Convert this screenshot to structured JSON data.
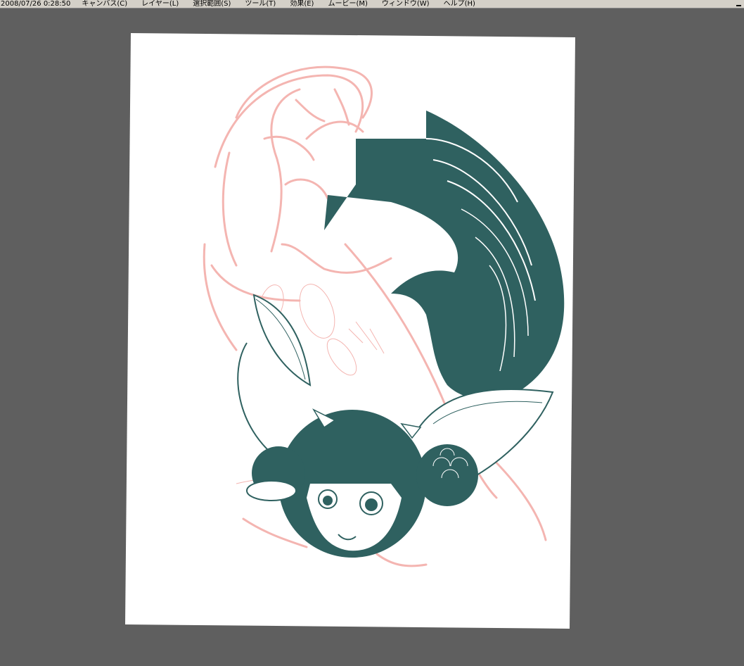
{
  "menubar": {
    "timestamp": "2008/07/26 0:28:50",
    "items": [
      {
        "label": "キャンバス(C)"
      },
      {
        "label": "レイヤー(L)"
      },
      {
        "label": "選択範囲(S)"
      },
      {
        "label": "ツール(T)"
      },
      {
        "label": "効果(E)"
      },
      {
        "label": "ムービー(M)"
      },
      {
        "label": "ウィンドウ(W)"
      },
      {
        "label": "ヘルプ(H)"
      }
    ]
  },
  "colors": {
    "workspace": "#5f5f5f",
    "menubar": "#d4d0c8",
    "paper": "#ffffff",
    "ink": "#2f6160",
    "sketch": "#f4b5b1"
  },
  "icons": {
    "minimize": "minimize-icon"
  }
}
